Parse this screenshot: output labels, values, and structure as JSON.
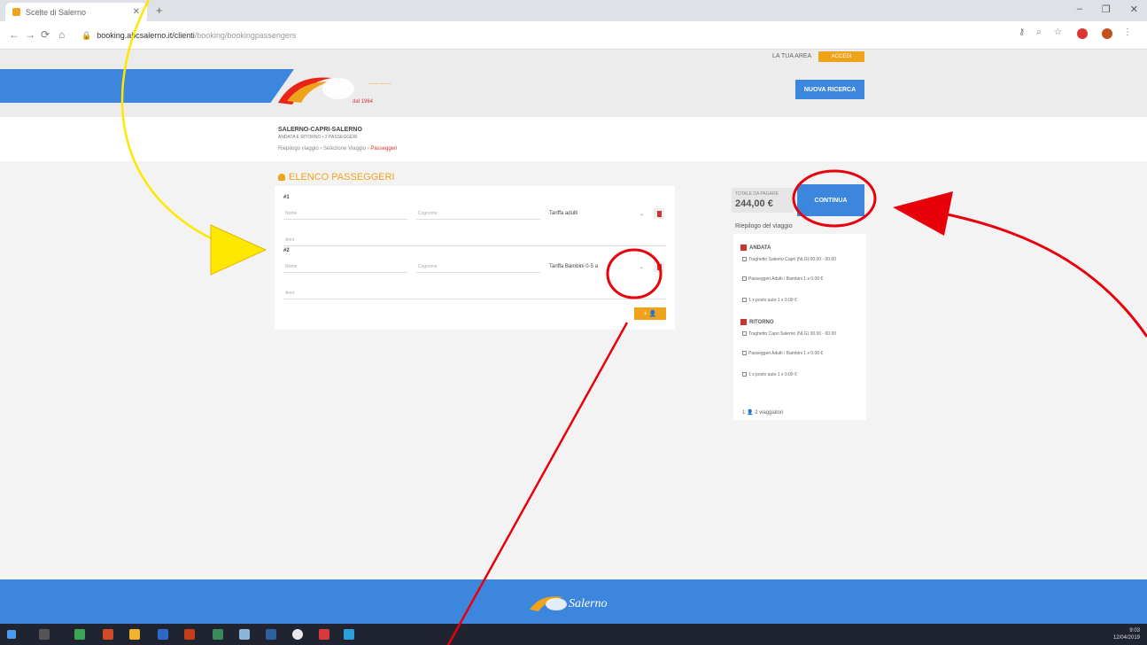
{
  "browser": {
    "tab_title": "Scelte di Salerno",
    "new_tab": "+",
    "url_domain": "booking.abcsalerno.it/clienti",
    "url_path": "/booking/bookingpassengers",
    "window_buttons": [
      "–",
      "❐",
      "✕"
    ]
  },
  "header": {
    "user_link": "LA TUA AREA",
    "user_badge": "ACCEDI",
    "logo_tag": "dal 1964",
    "action_button": "NUOVA RICERCA"
  },
  "trip": {
    "title": "SALERNO-CAPRI-SALERNO",
    "subtitle": "ANDATA E RITORNO • 2 PASSEGGERI",
    "crumbs": [
      "Riepilogo viaggio",
      "Selezione Viaggio"
    ],
    "crumb_active": "Passeggeri"
  },
  "passengers": {
    "section_title": "ELENCO PASSEGGERI",
    "add_button": "+ 👤",
    "items": [
      {
        "label": "#1",
        "name_placeholder": "Nome",
        "surname_placeholder": "Cognome",
        "tariff": "Tariffa adulti",
        "age_placeholder": "Anni"
      },
      {
        "label": "#2",
        "name_placeholder": "Nome",
        "surname_placeholder": "Cognome",
        "tariff": "Tariffa Bambini 0-5 a",
        "age_placeholder": "Anni"
      }
    ]
  },
  "summary": {
    "total_label": "TOTALE DA PAGARE",
    "total_value": "244,00 €",
    "continue_button": "CONTINUA",
    "title": "Riepilogo del viaggio",
    "sections": [
      {
        "title": "ANDATA",
        "lines": [
          "Traghetto Salerno Capri (NLG) 00.00 - 00.00",
          "Passeggeri Adulti / Bambini 1 x 0.00 €",
          "1 x posto auto 1 x 0.00 €"
        ]
      },
      {
        "title": "RITORNO",
        "lines": [
          "Traghetto Capri Salerno (NLG) 00.00 - 00.00",
          "Passeggeri Adulti / Bambini 1 x 0.00 €",
          "1 x posto auto 1 x 0.00 €"
        ]
      }
    ],
    "footer": "1 👤 2 viaggiatori"
  },
  "footer": {
    "logo_text": "Salerno"
  },
  "taskbar": {
    "time": "9:03",
    "date": "12/04/2019"
  },
  "colors": {
    "primary": "#3c86de",
    "accent": "#f0a21b",
    "danger": "#c33333",
    "annotation_red": "#e8000b",
    "annotation_yellow": "#ffe800"
  }
}
